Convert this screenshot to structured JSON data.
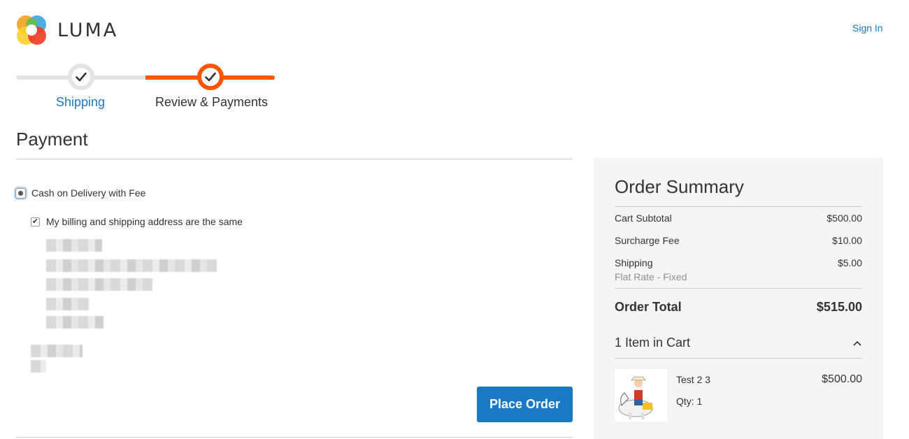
{
  "header": {
    "logo_text": "LUMA",
    "sign_in": "Sign In"
  },
  "progress": {
    "steps": [
      {
        "label": "Shipping",
        "status": "complete"
      },
      {
        "label": "Review & Payments",
        "status": "active"
      }
    ]
  },
  "payment": {
    "title": "Payment",
    "method_label": "Cash on Delivery with Fee",
    "billing_same_label": "My billing and shipping address are the same",
    "billing_same_checked": true,
    "place_order": "Place Order"
  },
  "summary": {
    "title": "Order Summary",
    "rows": [
      {
        "label": "Cart Subtotal",
        "value": "$500.00"
      },
      {
        "label": "Surcharge Fee",
        "value": "$10.00"
      },
      {
        "label": "Shipping",
        "value": "$5.00",
        "note": "Flat Rate - Fixed"
      }
    ],
    "total_label": "Order Total",
    "total_value": "$515.00",
    "items_title": "1 Item in Cart",
    "item": {
      "name": "Test 2 3",
      "qty": "Qty: 1",
      "price": "$500.00"
    }
  },
  "colors": {
    "accent_blue": "#1979c3",
    "progress_orange": "#ff5501",
    "progress_grey": "#e4e4e4",
    "summary_bg": "#f5f5f5"
  }
}
